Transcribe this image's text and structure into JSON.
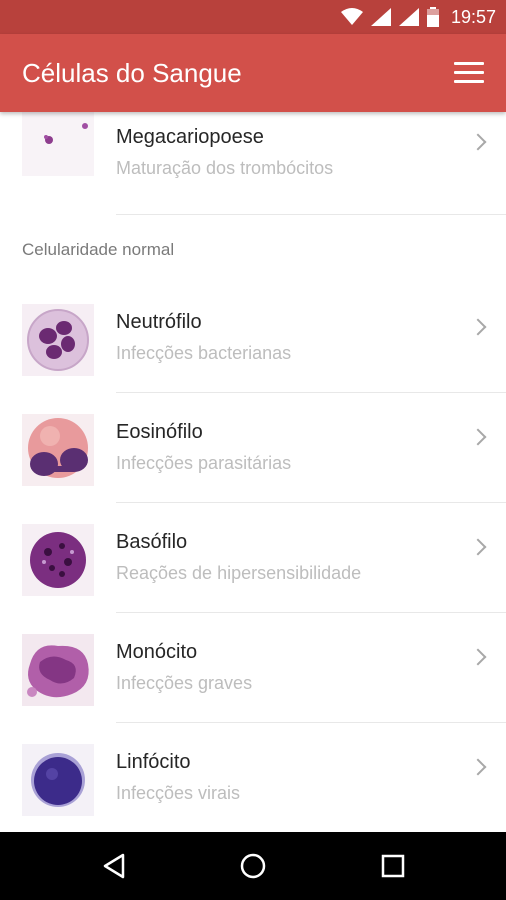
{
  "status_bar": {
    "time": "19:57"
  },
  "app_bar": {
    "title": "Células do Sangue"
  },
  "list": {
    "top_item": {
      "title": "Megacariopoese",
      "subtitle": "Maturação dos trombócitos"
    },
    "section_header": "Celularidade normal",
    "items": [
      {
        "title": "Neutrófilo",
        "subtitle": "Infecções bacterianas"
      },
      {
        "title": "Eosinófilo",
        "subtitle": "Infecções parasitárias"
      },
      {
        "title": "Basófilo",
        "subtitle": "Reações de hipersensibilidade"
      },
      {
        "title": "Monócito",
        "subtitle": "Infecções graves"
      },
      {
        "title": "Linfócito",
        "subtitle": "Infecções virais"
      }
    ]
  },
  "colors": {
    "status_bar": "#b8413c",
    "app_bar": "#d2504a",
    "nav_bar": "#000000"
  }
}
